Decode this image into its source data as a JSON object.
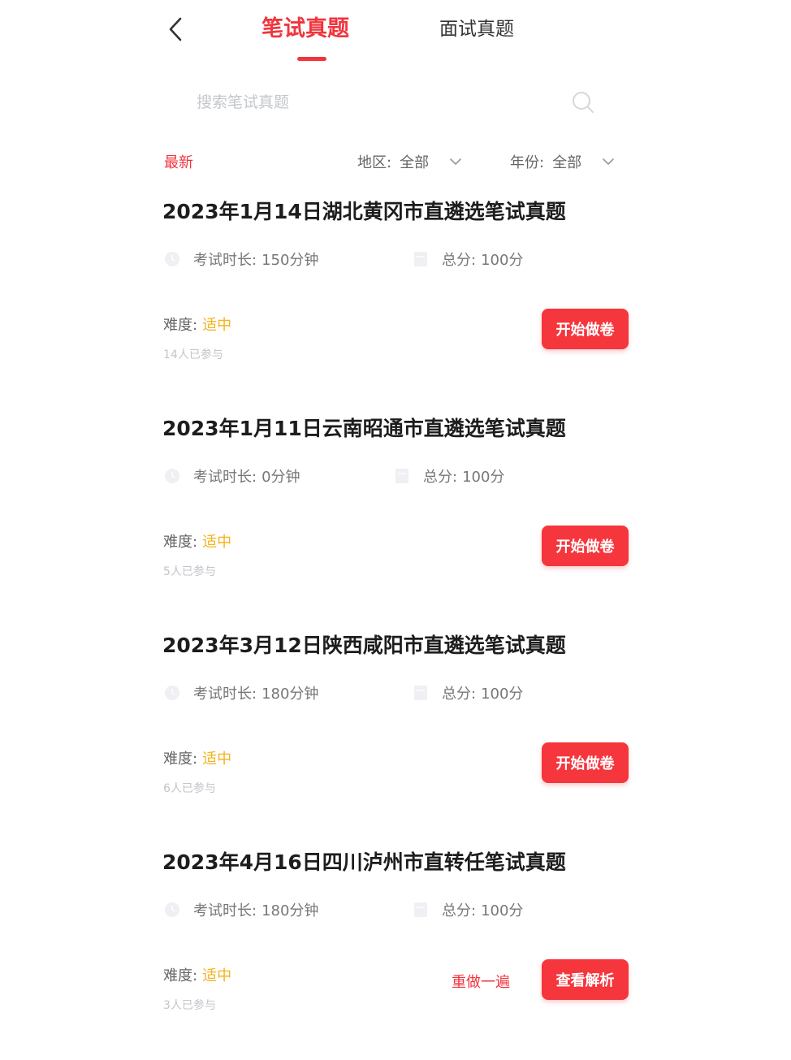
{
  "header": {
    "tabs": [
      {
        "label": "笔试真题",
        "active": true
      },
      {
        "label": "面试真题",
        "active": false
      }
    ]
  },
  "search": {
    "placeholder": "搜索笔试真题",
    "value": ""
  },
  "filters": {
    "latest": "最新",
    "region": {
      "label": "地区:",
      "value": "全部"
    },
    "year": {
      "label": "年份:",
      "value": "全部"
    }
  },
  "labels": {
    "duration": "考试时长:",
    "score": "总分:",
    "difficulty": "难度:"
  },
  "exams": [
    {
      "title": "2023年1月14日湖北黄冈市直遴选笔试真题",
      "duration": "150分钟",
      "score": "100分",
      "difficulty": "适中",
      "participants": "14人已参与",
      "primary_action": "开始做卷"
    },
    {
      "title": "2023年1月11日云南昭通市直遴选笔试真题",
      "duration": "0分钟",
      "score": "100分",
      "difficulty": "适中",
      "participants": "5人已参与",
      "primary_action": "开始做卷"
    },
    {
      "title": "2023年3月12日陕西咸阳市直遴选笔试真题",
      "duration": "180分钟",
      "score": "100分",
      "difficulty": "适中",
      "participants": "6人已参与",
      "primary_action": "开始做卷"
    },
    {
      "title": "2023年4月16日四川泸州市直转任笔试真题",
      "duration": "180分钟",
      "score": "100分",
      "difficulty": "适中",
      "participants": "3人已参与",
      "secondary_action": "重做一遍",
      "primary_action": "查看解析"
    }
  ],
  "colors": {
    "accent": "#f0353e",
    "button": "#f5363d",
    "difficulty": "#f5b21b"
  },
  "icons": {
    "back": "chevron-left-icon",
    "search": "search-icon",
    "dropdown": "chevron-down-icon",
    "duration": "clock-icon",
    "score": "document-icon"
  }
}
